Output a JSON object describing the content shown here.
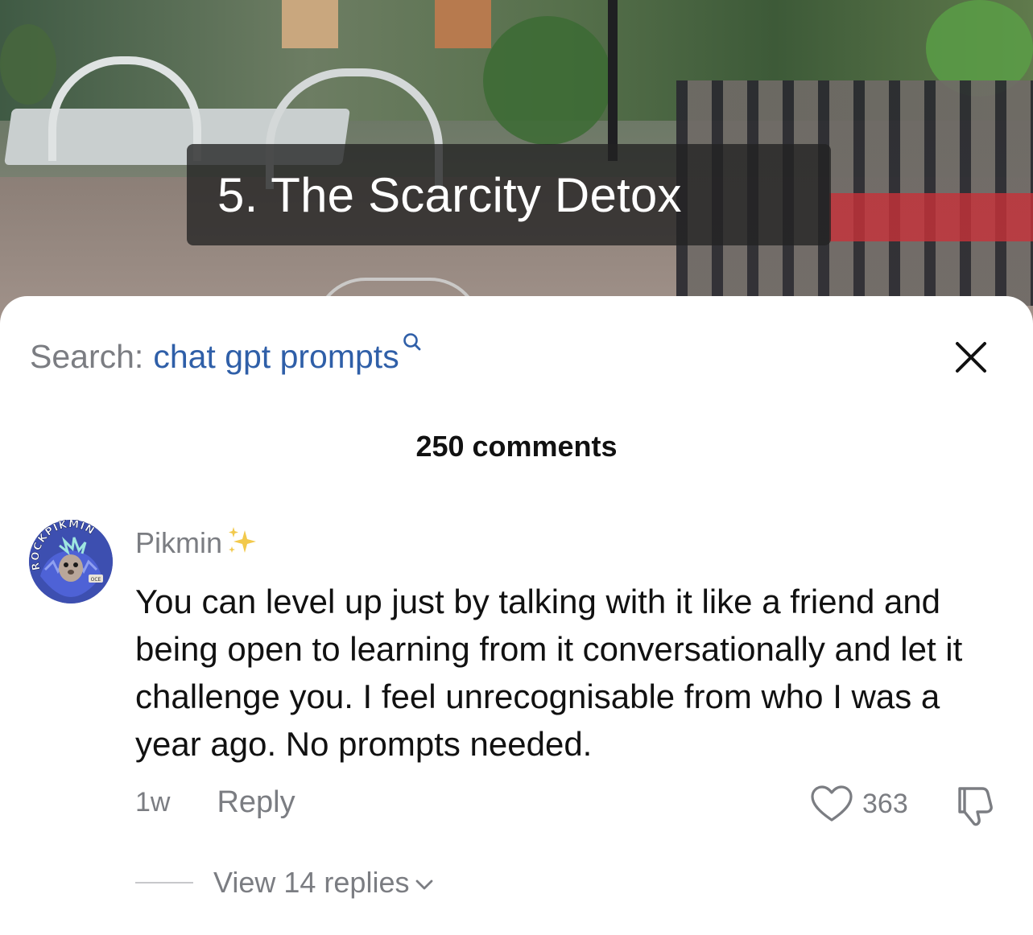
{
  "video": {
    "overlay_title": "5. The Scarcity Detox"
  },
  "sheet": {
    "search_prefix": "Search:",
    "search_query": "chat gpt prompts",
    "search_icon": "magnifier-icon",
    "close_icon": "close-icon",
    "comment_count": "250 comments"
  },
  "comment": {
    "avatar_ring_text": "ROCKPIKMIN",
    "avatar_badge": "OCE",
    "username": "Pikmin",
    "username_icon": "sparkles-icon",
    "text": "You can level up just by talking with it like a friend and being open to learning from it conversationally and let it challenge you. I feel unrecognisable from who I was a year ago. No prompts needed.",
    "time_ago": "1w",
    "reply_label": "Reply",
    "like_icon": "heart-outline-icon",
    "like_count": "363",
    "dislike_icon": "thumbs-down-icon",
    "view_replies_label": "View 14 replies",
    "view_replies_icon": "chevron-down-icon"
  },
  "colors": {
    "search_query": "#2f5fa8",
    "muted_text": "#7b7d82",
    "primary_text": "#111111",
    "sparkle_gold": "#f2c94c",
    "overlay_bg": "#232323"
  }
}
